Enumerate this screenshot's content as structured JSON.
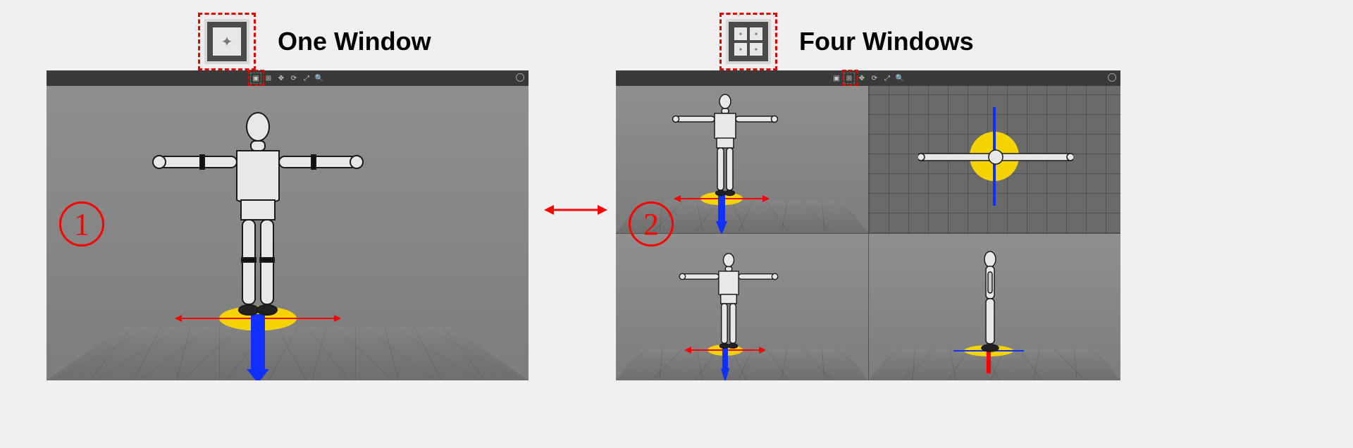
{
  "labels": {
    "one_window": "One Window",
    "four_windows": "Four Windows"
  },
  "markers": {
    "id1": "1",
    "id2": "2"
  },
  "toolbar": {
    "layout_one": "one-window-layout",
    "layout_four": "four-window-layout",
    "tool_move": "move",
    "tool_rotate": "rotate",
    "tool_scale": "scale",
    "tool_zoom": "zoom",
    "fullscreen": "fullscreen"
  }
}
